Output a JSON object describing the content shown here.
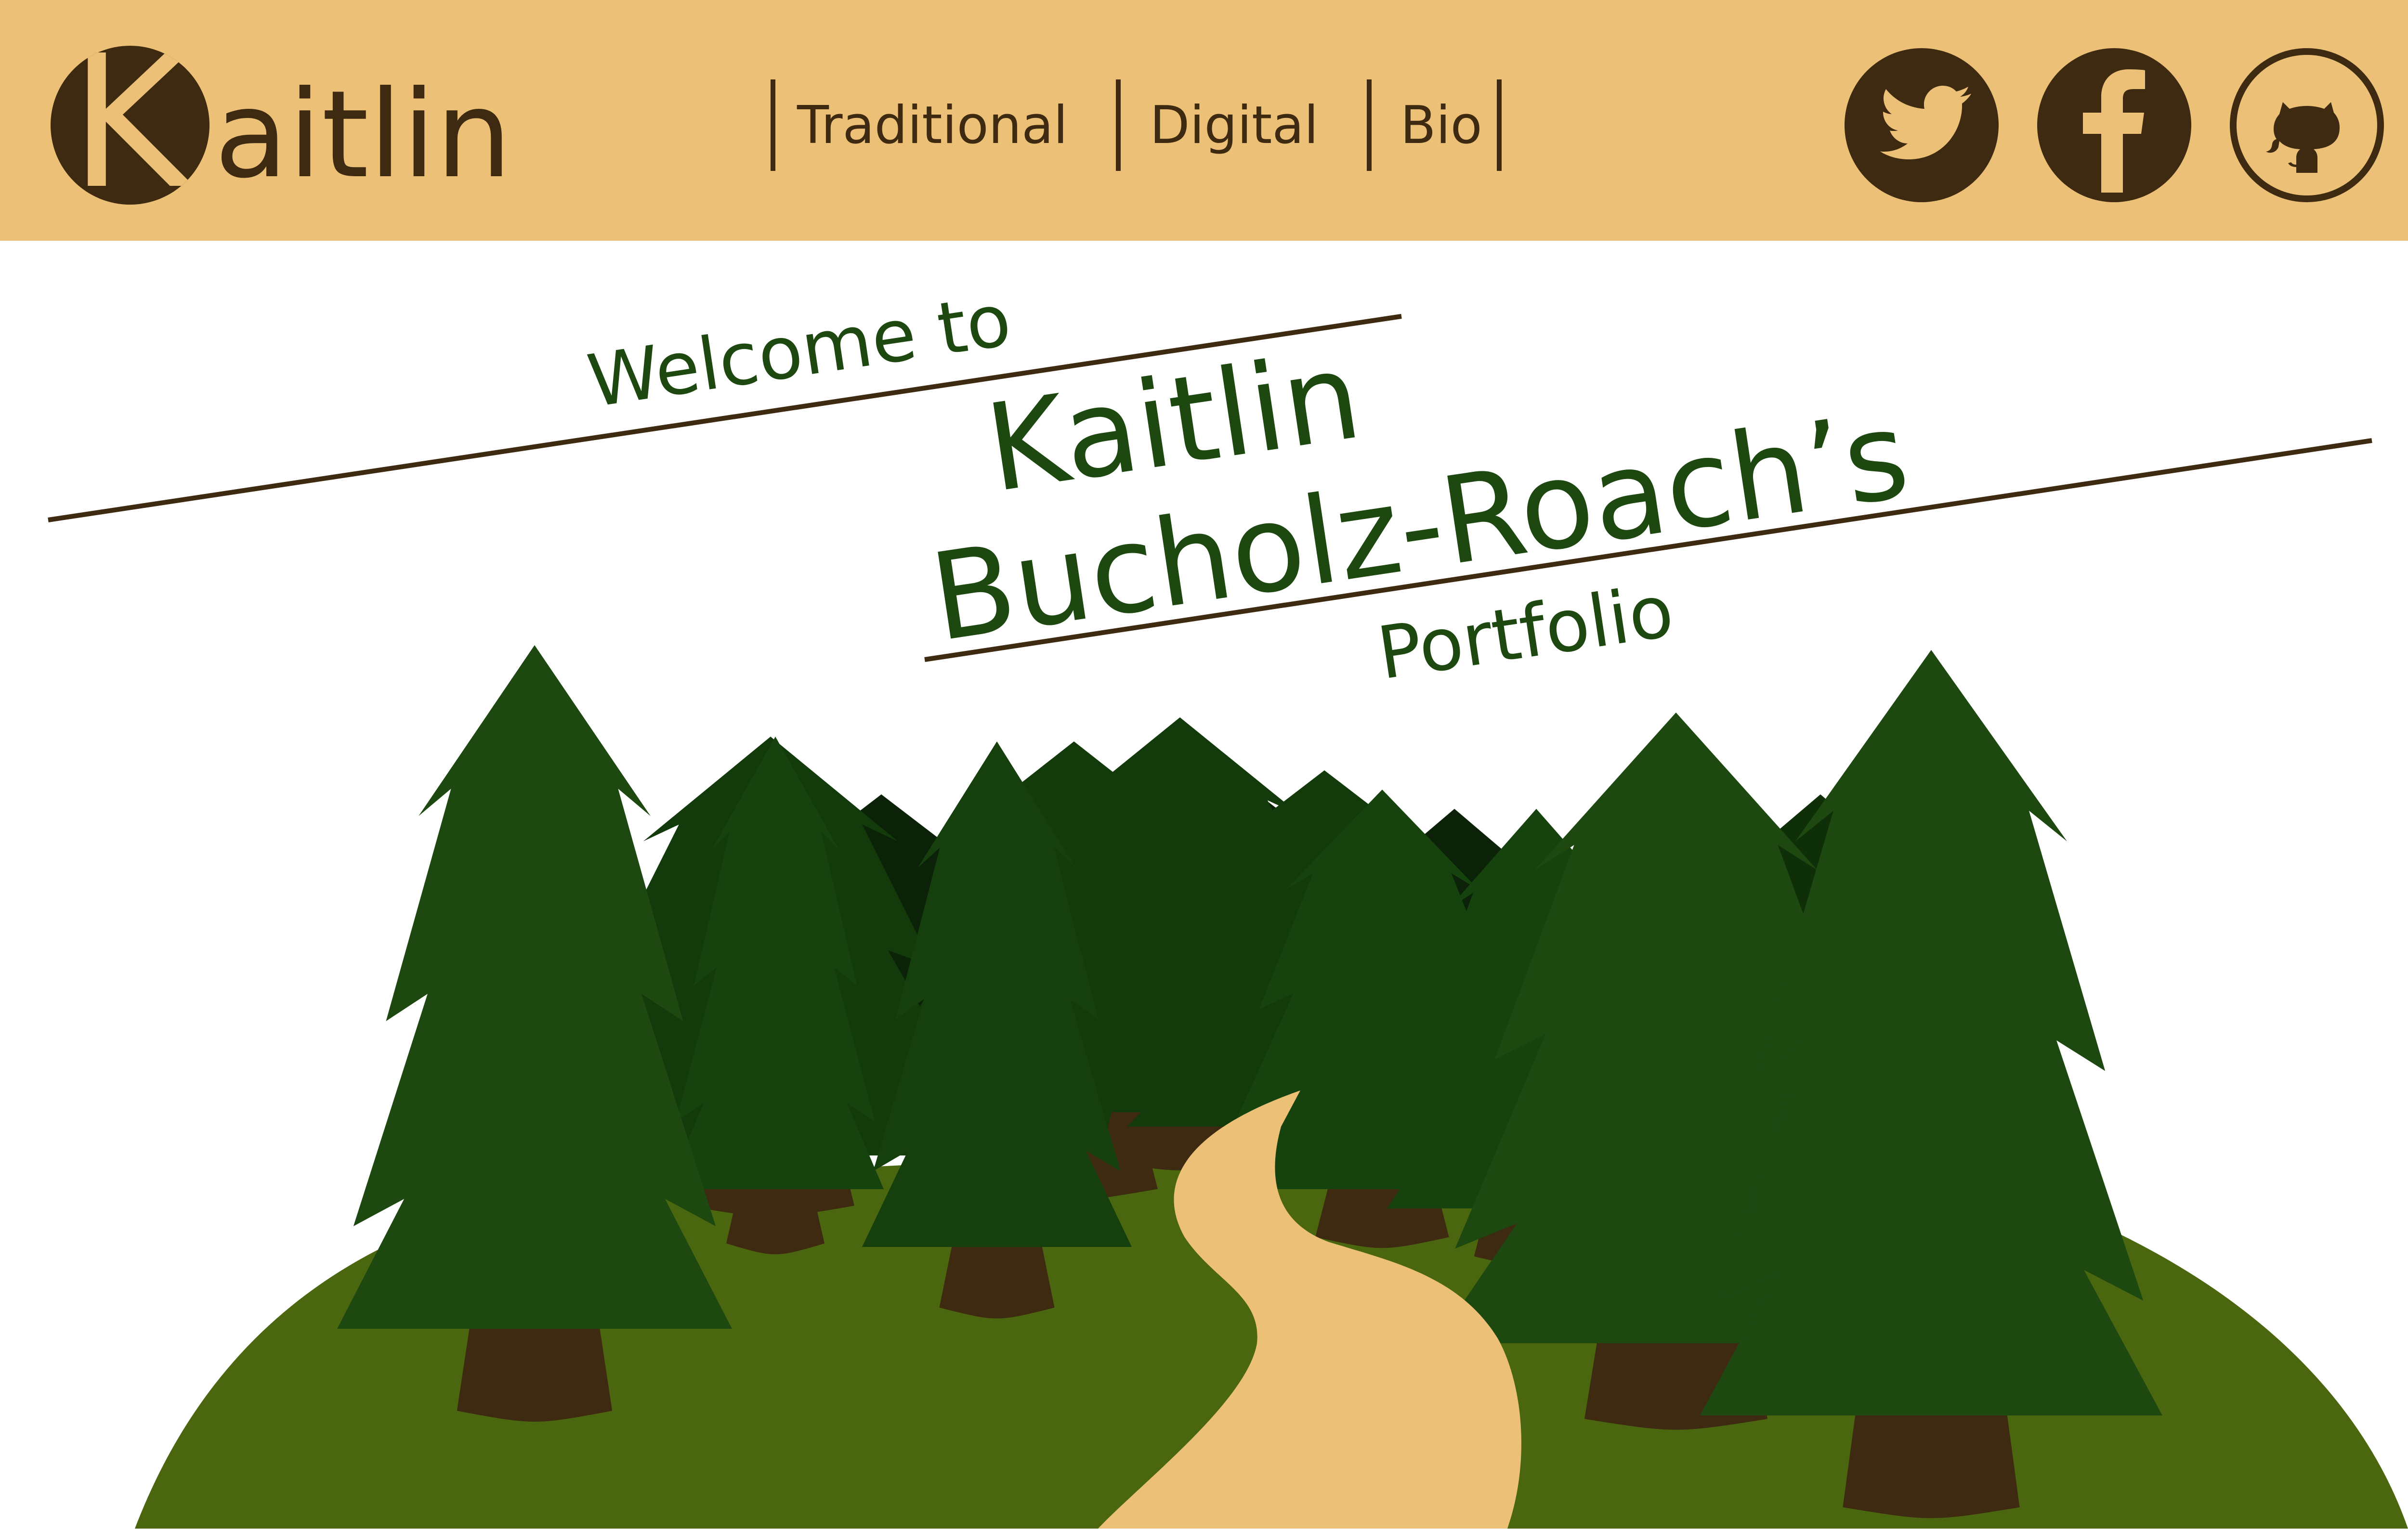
{
  "header": {
    "logo_text": "aitlin",
    "logo_letter": "K",
    "nav": [
      {
        "label": "Traditional"
      },
      {
        "label": "Digital"
      },
      {
        "label": "Bio"
      }
    ],
    "social": [
      {
        "icon": "twitter-icon"
      },
      {
        "icon": "facebook-icon"
      },
      {
        "icon": "github-icon"
      }
    ]
  },
  "hero": {
    "line1": "Welcome to",
    "line2": "Kaitlin",
    "line3": "Bucholz-Roach’s",
    "line4": "Portfolio"
  },
  "colors": {
    "header_bg": "#edc077",
    "brown": "#3d2a10",
    "title_green": "#1d4911",
    "grass": "#4a670f",
    "path": "#edc077"
  }
}
